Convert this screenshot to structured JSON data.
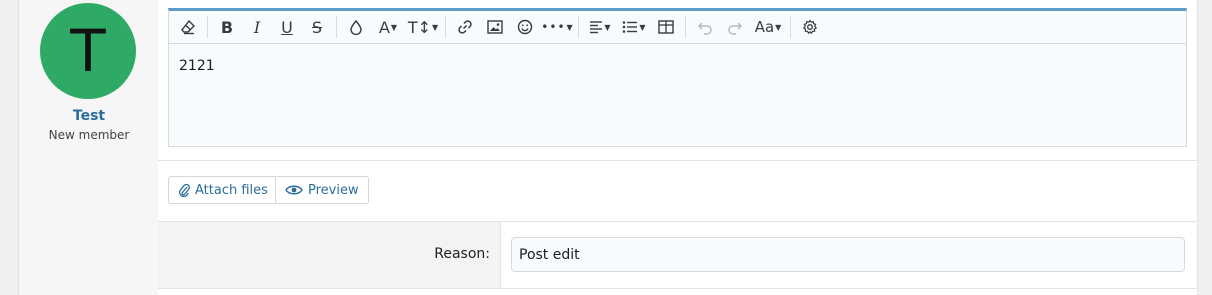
{
  "user": {
    "avatar_letter": "T",
    "avatar_color": "#2eaa66",
    "name": "Test",
    "title": "New member"
  },
  "toolbar": {
    "buttons": [
      {
        "name": "remove-formatting-icon",
        "glyph": "⌫",
        "enabled": true
      },
      {
        "name": "bold-icon",
        "glyph": "B",
        "enabled": true
      },
      {
        "name": "italic-icon",
        "glyph": "I",
        "enabled": true
      },
      {
        "name": "underline-icon",
        "glyph": "U",
        "enabled": true
      },
      {
        "name": "strikethrough-icon",
        "glyph": "S",
        "enabled": true
      },
      {
        "name": "text-color-icon",
        "glyph": "◊",
        "enabled": true
      },
      {
        "name": "font-family-icon",
        "glyph": "A",
        "enabled": true
      },
      {
        "name": "font-size-icon",
        "glyph": "T↕",
        "enabled": true
      },
      {
        "name": "link-icon",
        "glyph": "🔗",
        "enabled": true
      },
      {
        "name": "image-icon",
        "glyph": "▣",
        "enabled": true
      },
      {
        "name": "emoji-icon",
        "glyph": "☺",
        "enabled": true
      },
      {
        "name": "more-options-icon",
        "glyph": "•••",
        "enabled": true
      },
      {
        "name": "align-icon",
        "glyph": "≡",
        "enabled": true
      },
      {
        "name": "list-icon",
        "glyph": "☰",
        "enabled": true
      },
      {
        "name": "table-icon",
        "glyph": "⊞",
        "enabled": true
      },
      {
        "name": "undo-icon",
        "glyph": "↶",
        "enabled": false
      },
      {
        "name": "redo-icon",
        "glyph": "↷",
        "enabled": false
      },
      {
        "name": "text-style-icon",
        "glyph": "Aa",
        "enabled": true
      },
      {
        "name": "settings-icon",
        "glyph": "⚙",
        "enabled": true
      }
    ]
  },
  "editor": {
    "content": "2121"
  },
  "actions": {
    "attach_label": "Attach files",
    "preview_label": "Preview"
  },
  "reason": {
    "label": "Reason:",
    "value": "Post edit"
  },
  "colors": {
    "accent": "#2b6e9a",
    "editor_top_border": "#5d9bc7"
  }
}
